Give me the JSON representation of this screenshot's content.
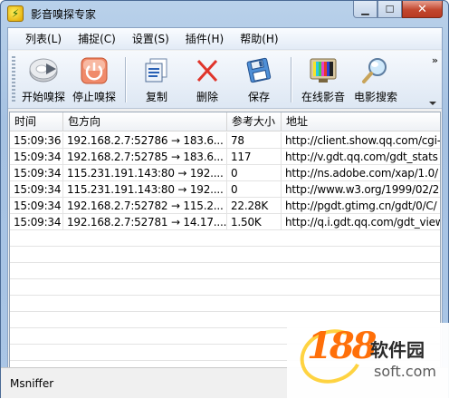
{
  "window": {
    "title": "影音嗅探专家"
  },
  "menu": [
    "列表(L)",
    "捕捉(C)",
    "设置(S)",
    "插件(H)",
    "帮助(H)"
  ],
  "toolbar": {
    "start": "开始嗅探",
    "stop": "停止嗅探",
    "copy": "复制",
    "delete": "删除",
    "save": "保存",
    "online": "在线影音",
    "search": "电影搜索",
    "more": "»"
  },
  "columns": [
    "时间",
    "包方向",
    "参考大小",
    "地址"
  ],
  "rows": [
    {
      "time": "15:09:36",
      "direction": "192.168.2.7:52786 → 183.6...",
      "size": "78",
      "url": "http://client.show.qq.com/cgi-"
    },
    {
      "time": "15:09:34",
      "direction": "192.168.2.7:52785 → 183.6...",
      "size": "117",
      "url": "http://v.gdt.qq.com/gdt_stats"
    },
    {
      "time": "15:09:34",
      "direction": "115.231.191.143:80 → 192....",
      "size": "0",
      "url": "http://ns.adobe.com/xap/1.0/"
    },
    {
      "time": "15:09:34",
      "direction": "115.231.191.143:80 → 192....",
      "size": "0",
      "url": "http://www.w3.org/1999/02/2"
    },
    {
      "time": "15:09:34",
      "direction": "192.168.2.7:52782 → 115.2...",
      "size": "22.28K",
      "url": "http://pgdt.gtimg.cn/gdt/0/C/"
    },
    {
      "time": "15:09:34",
      "direction": "192.168.2.7:52781 → 14.17....",
      "size": "1.50K",
      "url": "http://q.i.gdt.qq.com/gdt_view"
    }
  ],
  "scrollbar": {
    "thumb_position": 0.02,
    "thumb_fraction": 0.47
  },
  "status": {
    "text": "Msniffer"
  },
  "watermark": {
    "number": "188",
    "brand": "软件园",
    "domain": "soft.com"
  }
}
